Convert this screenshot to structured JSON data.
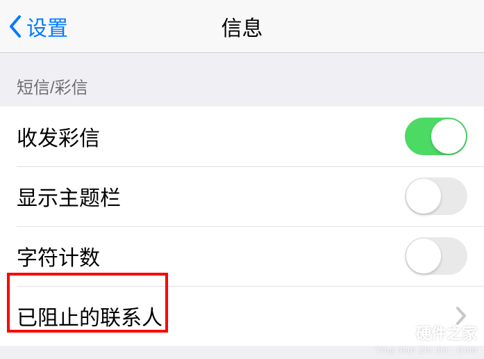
{
  "nav": {
    "back_label": "设置",
    "title": "信息"
  },
  "section": {
    "header": "短信/彩信"
  },
  "rows": {
    "mms": {
      "label": "收发彩信",
      "on": true
    },
    "subject": {
      "label": "显示主题栏",
      "on": false
    },
    "charcount": {
      "label": "字符计数",
      "on": false
    },
    "blocked": {
      "label": "已阻止的联系人"
    }
  },
  "watermark": {
    "title": "硬件之家",
    "sub": "Ying Jian Zhi Jia . Com"
  }
}
